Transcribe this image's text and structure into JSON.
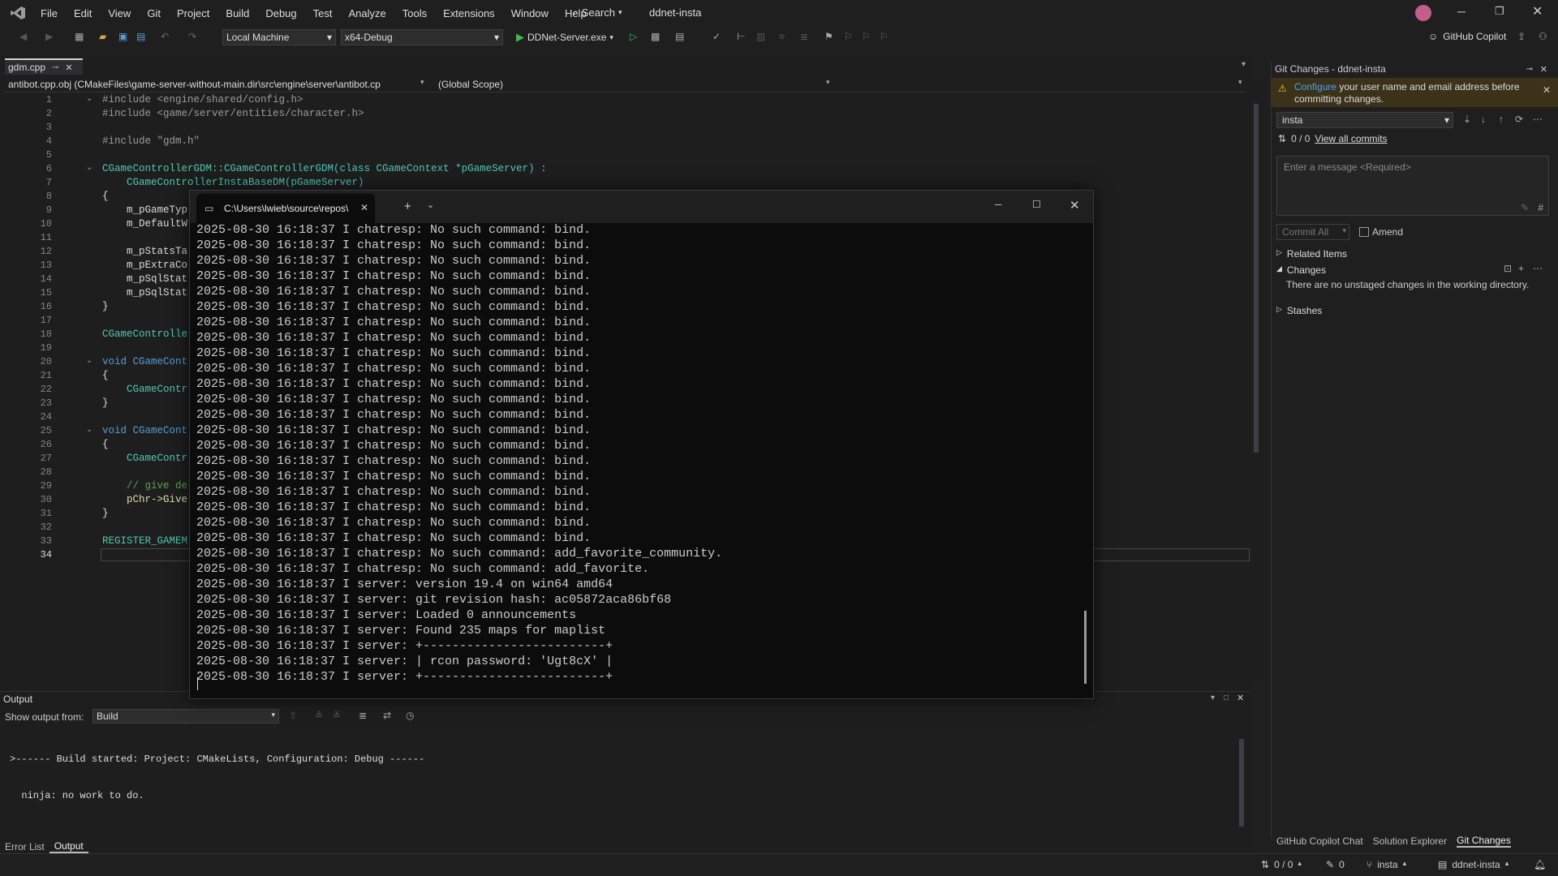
{
  "menu": [
    "File",
    "Edit",
    "View",
    "Git",
    "Project",
    "Build",
    "Debug",
    "Test",
    "Analyze",
    "Tools",
    "Extensions",
    "Window",
    "Help"
  ],
  "search_label": "Search",
  "solution_name": "ddnet-insta",
  "toolbar": {
    "target_machine": "Local Machine",
    "configuration": "x64-Debug",
    "run_target": "DDNet-Server.exe",
    "copilot_label": "GitHub Copilot"
  },
  "editor": {
    "tab_name": "gdm.cpp",
    "nav_file": "antibot.cpp.obj (CMakeFiles\\game-server-without-main.dir\\src\\engine\\server\\antibot.cp",
    "nav_scope": "(Global Scope)",
    "line_numbers": [
      "1",
      "2",
      "3",
      "4",
      "5",
      "6",
      "7",
      "8",
      "9",
      "10",
      "11",
      "12",
      "13",
      "14",
      "15",
      "16",
      "17",
      "18",
      "19",
      "20",
      "21",
      "22",
      "23",
      "24",
      "25",
      "26",
      "27",
      "28",
      "29",
      "30",
      "31",
      "32",
      "33",
      "34"
    ],
    "lines": {
      "l1": "#include <engine/shared/config.h>",
      "l2": "#include <game/server/entities/character.h>",
      "l4": "#include \"gdm.h\"",
      "l6": "CGameControllerGDM::CGameControllerGDM(class CGameContext *pGameServer) :",
      "l7": "    CGameControllerInstaBaseDM(pGameServer)",
      "l8": "{",
      "l9": "    m_pGameTyp",
      "l10": "    m_DefaultW",
      "l12": "    m_pStatsTa",
      "l13": "    m_pExtraCo",
      "l14": "    m_pSqlStat",
      "l15": "    m_pSqlStat",
      "l16": "}",
      "l18": "CGameControlle",
      "l20": "void CGameCont",
      "l21": "{",
      "l22": "    CGameContr",
      "l23": "}",
      "l25": "void CGameCont",
      "l26": "{",
      "l27": "    CGameContr",
      "l29": "    // give de",
      "l30": "    pChr->Give",
      "l31": "}",
      "l33": "REGISTER_GAMEM"
    }
  },
  "terminal": {
    "tab_title": "C:\\Users\\lwieb\\source\\repos\\",
    "lines": [
      "2025-08-30 16:18:37 I chatresp: No such command: bind.",
      "2025-08-30 16:18:37 I chatresp: No such command: bind.",
      "2025-08-30 16:18:37 I chatresp: No such command: bind.",
      "2025-08-30 16:18:37 I chatresp: No such command: bind.",
      "2025-08-30 16:18:37 I chatresp: No such command: bind.",
      "2025-08-30 16:18:37 I chatresp: No such command: bind.",
      "2025-08-30 16:18:37 I chatresp: No such command: bind.",
      "2025-08-30 16:18:37 I chatresp: No such command: bind.",
      "2025-08-30 16:18:37 I chatresp: No such command: bind.",
      "2025-08-30 16:18:37 I chatresp: No such command: bind.",
      "2025-08-30 16:18:37 I chatresp: No such command: bind.",
      "2025-08-30 16:18:37 I chatresp: No such command: bind.",
      "2025-08-30 16:18:37 I chatresp: No such command: bind.",
      "2025-08-30 16:18:37 I chatresp: No such command: bind.",
      "2025-08-30 16:18:37 I chatresp: No such command: bind.",
      "2025-08-30 16:18:37 I chatresp: No such command: bind.",
      "2025-08-30 16:18:37 I chatresp: No such command: bind.",
      "2025-08-30 16:18:37 I chatresp: No such command: bind.",
      "2025-08-30 16:18:37 I chatresp: No such command: bind.",
      "2025-08-30 16:18:37 I chatresp: No such command: bind.",
      "2025-08-30 16:18:37 I chatresp: No such command: bind.",
      "2025-08-30 16:18:37 I chatresp: No such command: add_favorite_community.",
      "2025-08-30 16:18:37 I chatresp: No such command: add_favorite.",
      "2025-08-30 16:18:37 I server: version 19.4 on win64 amd64",
      "2025-08-30 16:18:37 I server: git revision hash: ac05872aca86bf68",
      "2025-08-30 16:18:37 I server: Loaded 0 announcements",
      "2025-08-30 16:18:37 I server: Found 235 maps for maplist",
      "2025-08-30 16:18:37 I server: +-------------------------+",
      "2025-08-30 16:18:37 I server: | rcon password: 'Ugt8cX' |",
      "2025-08-30 16:18:37 I server: +-------------------------+"
    ]
  },
  "output": {
    "title": "Output",
    "show_from_label": "Show output from:",
    "source": "Build",
    "lines": [
      ">------ Build started: Project: CMakeLists, Configuration: Debug ------",
      "  ninja: no work to do."
    ],
    "tabs": [
      "Error List",
      "Output"
    ]
  },
  "git": {
    "title": "Git Changes - ddnet-insta",
    "warning_link": "Configure",
    "warning_text": " your user name and email address before committing changes.",
    "branch": "insta",
    "commits_count": "0 / 0",
    "view_all_commits": "View all commits",
    "message_placeholder": "Enter a message <Required>",
    "commit_all": "Commit All",
    "amend": "Amend",
    "related_items": "Related Items",
    "changes": "Changes",
    "no_changes": "There are no unstaged changes in the working directory.",
    "stashes": "Stashes",
    "bottom_tabs": [
      "GitHub Copilot Chat",
      "Solution Explorer",
      "Git Changes"
    ]
  },
  "status": {
    "sync": "0 / 0",
    "edits": "0",
    "branch": "insta",
    "repo": "ddnet-insta"
  },
  "colors": {
    "accent": "#569cd6",
    "warning": "#3b3219",
    "link": "#4aa3ff",
    "run": "#3fb950"
  }
}
